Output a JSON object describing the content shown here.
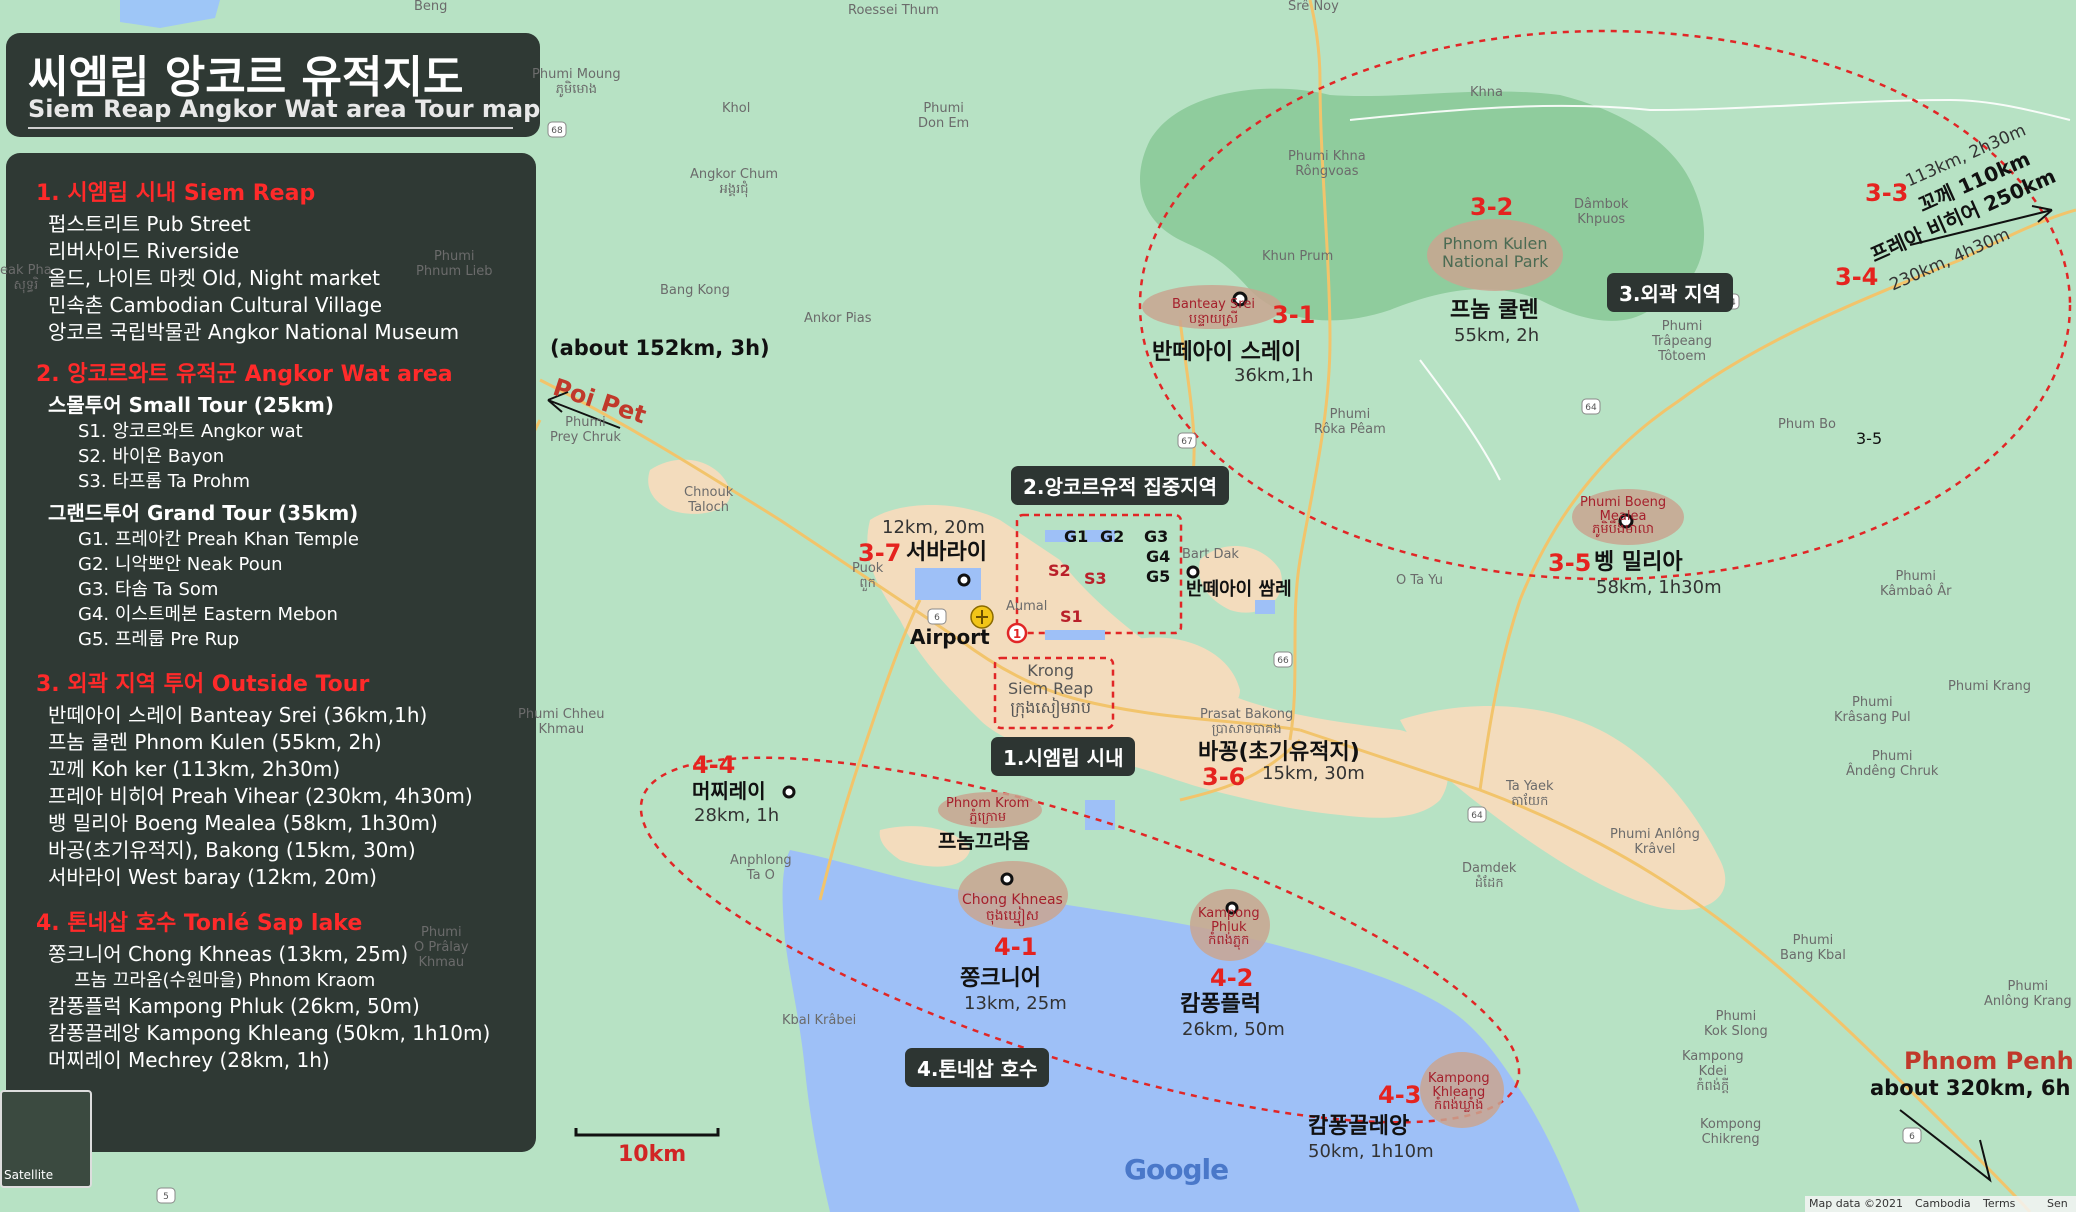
{
  "title": {
    "korean": "씨엠립 앙코르 유적지도",
    "english": "Siem Reap Angkor Wat area Tour map"
  },
  "legend": {
    "sections": [
      {
        "heading": "1. 시엠립 시내 Siem Reap",
        "lines": [
          "펍스트리트 Pub Street",
          "리버사이드 Riverside",
          "올드, 나이트 마켓 Old, Night market",
          "민속촌 Cambodian Cultural Village",
          "앙코르 국립박물관 Angkor National Museum"
        ]
      },
      {
        "heading": "2. 앙코르와트 유적군 Angkor Wat area",
        "small_tour": "스몰투어 Small Tour (25km)",
        "small_items": [
          "S1. 앙코르와트 Angkor wat",
          "S2. 바이욘 Bayon",
          "S3. 타프롬 Ta Prohm"
        ],
        "grand_tour": "그랜드투어 Grand Tour (35km)",
        "grand_items": [
          "G1. 프레아칸 Preah Khan Temple",
          "G2. 니악뽀안 Neak Poun",
          "G3. 타솜 Ta Som",
          "G4. 이스트메본 Eastern Mebon",
          "G5. 프레룹 Pre Rup"
        ]
      },
      {
        "heading": "3. 외곽 지역 투어 Outside Tour",
        "lines": [
          "반떼아이 스레이 Banteay Srei (36km,1h)",
          "프놈 쿨렌 Phnom Kulen (55km, 2h)",
          "꼬께 Koh ker  (113km, 2h30m)",
          "프레아 비히어 Preah Vihear (230km, 4h30m)",
          "뱅 밀리아 Boeng Mealea (58km, 1h30m)",
          "바공(초기유적지), Bakong (15km, 30m)",
          "서바라이 West baray (12km, 20m)"
        ]
      },
      {
        "heading": "4. 톤네삽 호수 Tonlé Sap lake",
        "lines": [
          "쫑크니어 Chong Khneas (13km, 25m)",
          "프놈 끄라옴(수원마을) Phnom Kraom",
          "캄퐁플럭 Kampong Phluk (26km, 50m)",
          "캄퐁끌레앙 Kampong Khleang (50km, 1h10m)",
          "머찌레이 Mechrey (28km, 1h)"
        ]
      }
    ]
  },
  "region_tags": {
    "siem_reap": "1.시엠립 시내",
    "angkor": "2.앙코르유적 집중지역",
    "outside": "3.외곽 지역",
    "lake": "4.톤네삽 호수"
  },
  "sites": {
    "banteay_srei": {
      "num": "3-1",
      "name": "반떼아이 스레이",
      "dist": "36km,1h",
      "map": "Banteay Srei\nបន្ទាយស្រី"
    },
    "phnom_kulen": {
      "num": "3-2",
      "name": "프놈 쿨렌",
      "dist": "55km, 2h",
      "map": "Phnom Kulen\nNational Park"
    },
    "koh_ker": {
      "num": "3-3",
      "name": "꼬께  110km",
      "dist": "113km, 2h30m"
    },
    "preah_vihear": {
      "num": "3-4",
      "name": "프레아 비히어 250km",
      "dist": "230km, 4h30m"
    },
    "beng_mealea": {
      "num": "3-5",
      "name": "벵 밀리아",
      "dist": "58km, 1h30m",
      "map": "Phumi Boeng\nMealea\nភូមិបឹងមាលា"
    },
    "bakong": {
      "num": "3-6",
      "name": "바꽁(초기유적지)",
      "dist": "15km, 30m"
    },
    "west_baray": {
      "num": "3-7",
      "name": "서바라이",
      "dist": "12km, 20m"
    },
    "chong_khneas": {
      "num": "4-1",
      "name": "쫑크니어",
      "dist": "13km, 25m",
      "map": "Chong Khneas\nចុងឃ្នៀស"
    },
    "kampong_phluk": {
      "num": "4-2",
      "name": "캄퐁플럭",
      "dist": "26km, 50m",
      "map": "Kampong\nPhluk\nកំពង់ភ្លុក"
    },
    "kampong_khleang": {
      "num": "4-3",
      "name": "캄퐁끌레앙",
      "dist": "50km, 1h10m",
      "map": "Kampong\nKhleang\nកំពង់ឃ្លាំង"
    },
    "mechrey": {
      "num": "4-4",
      "name": "머찌레이",
      "dist": "28km, 1h"
    },
    "phnom_krom": {
      "name": "프놈끄라옴",
      "map": "Phnom Krom\nភ្នំក្រោម"
    },
    "banteay_samre": {
      "name": "반떼아이 쌈레"
    },
    "site_3_5_label": "3-5"
  },
  "temple_codes": [
    "G1",
    "G2",
    "G3",
    "G4",
    "G5",
    "S1",
    "S2",
    "S3"
  ],
  "airport": "Airport",
  "krong": "Krong\nSiem Reap\nក្រុងសៀមរាប",
  "poipet": {
    "dist": "(about 152km, 3h)",
    "name": "Poi Pet"
  },
  "phnom_penh": {
    "name": "Phnom Penh",
    "dist": "about 320km, 6h"
  },
  "scale": "10km",
  "google": "Google",
  "satellite": "Satellite",
  "attribution": [
    "Map data ©2021",
    "Cambodia",
    "Terms",
    "Sen"
  ],
  "places": [
    "Beng",
    "Roessei Thum",
    "Srê Noy",
    "Phumi Moung\nភូមិមោង",
    "Khna",
    "Khol",
    "Phumi\nDon Em",
    "Angkor Chum\nអង្គរជុំ",
    "Phumi Khna\nRôngvoas",
    "Dâmbok\nKhpuos",
    "Khun Prum",
    "Phumi\nPhnum Lieb",
    "Bang Kong",
    "Ankor Pias",
    "Phumi\nTrâpeang\nTôtoem",
    "Phumi\nRôka Pêam",
    "Phum Bo",
    "Phumi\nPrey Chruk",
    "Chnouk\nTaloch",
    "Puok\nពួក",
    "Aumal",
    "O Ta Yu",
    "Phumi\nKâmbaô Âr",
    "Phumi Chheu\nKhmau",
    "Prasat Bakong\nប្រាសាទបាគង",
    "Phumi\nKrâsang Pul",
    "Phumi Krang",
    "Phumi\nÂndêng Chruk",
    "Ta Yaek\nតាយែក",
    "Phumi Anlông\nKrâvel",
    "Damdek\nដំដែក",
    "Anphlong\nTa O",
    "Phumi\nO Prâlay\nKhmau",
    "Kbal Krâbei",
    "Phumi\nBang Kbal",
    "Phumi\nKok Slong",
    "Kampong\nKdei\nកំពង់ក្តី",
    "Kompong\nChikreng",
    "Phumi\nAnlông Krang",
    "Bart Dak",
    "eak Pha\nសុទ្ធរិ"
  ],
  "road_shields": [
    "68",
    "6",
    "67",
    "66",
    "64",
    "64",
    "64",
    "6",
    "5",
    "6"
  ]
}
